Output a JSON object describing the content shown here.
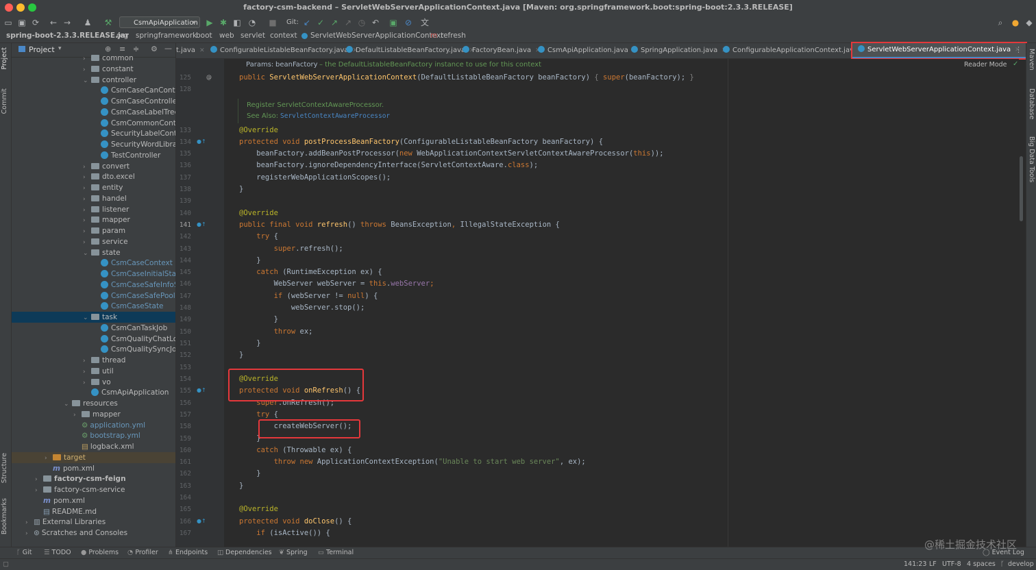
{
  "window": {
    "title": "factory-csm-backend – ServletWebServerApplicationContext.java [Maven: org.springframework.boot:spring-boot:2.3.3.RELEASE]"
  },
  "toolbar": {
    "run_config": "CsmApiApplication",
    "git_label": "Git:"
  },
  "navbar": {
    "crumbs": [
      "spring-boot-2.3.3.RELEASE.jar",
      "org",
      "springframework",
      "boot",
      "web",
      "servlet",
      "context",
      "ServletWebServerApplicationContext",
      "refresh"
    ]
  },
  "left_strip": {
    "project": "Project",
    "commit": "Commit",
    "structure": "Structure",
    "bookmarks": "Bookmarks"
  },
  "right_strip": {
    "maven": "Maven",
    "database": "Database",
    "bigdata": "Big Data Tools"
  },
  "project_panel": {
    "title": "Project",
    "tree": [
      {
        "label": "common",
        "type": "folder",
        "arrow": "›"
      },
      {
        "label": "constant",
        "type": "folder",
        "arrow": "›"
      },
      {
        "label": "controller",
        "type": "folder",
        "arrow": "⌄"
      },
      {
        "label": "CsmCaseCanControlle",
        "type": "class"
      },
      {
        "label": "CsmCaseController",
        "type": "class"
      },
      {
        "label": "CsmCaseLabelTreeCo",
        "type": "class"
      },
      {
        "label": "CsmCommonControlle",
        "type": "class"
      },
      {
        "label": "SecurityLabelControlle",
        "type": "class"
      },
      {
        "label": "SecurityWordLibraryCo",
        "type": "class"
      },
      {
        "label": "TestController",
        "type": "class"
      },
      {
        "label": "convert",
        "type": "folder",
        "arrow": "›"
      },
      {
        "label": "dto.excel",
        "type": "folder",
        "arrow": "›"
      },
      {
        "label": "entity",
        "type": "folder",
        "arrow": "›"
      },
      {
        "label": "handel",
        "type": "folder",
        "arrow": "›"
      },
      {
        "label": "listener",
        "type": "folder",
        "arrow": "›"
      },
      {
        "label": "mapper",
        "type": "folder",
        "arrow": "›"
      },
      {
        "label": "param",
        "type": "folder",
        "arrow": "›"
      },
      {
        "label": "service",
        "type": "folder",
        "arrow": "›"
      },
      {
        "label": "state",
        "type": "folder",
        "arrow": "⌄"
      },
      {
        "label": "CsmCaseContext",
        "type": "class",
        "vcs": true
      },
      {
        "label": "CsmCaseInitialState",
        "type": "class",
        "vcs": true
      },
      {
        "label": "CsmCaseSafeInfoStat",
        "type": "class",
        "vcs": true
      },
      {
        "label": "CsmCaseSafePoolStat",
        "type": "class",
        "vcs": true
      },
      {
        "label": "CsmCaseState",
        "type": "class",
        "vcs": true
      },
      {
        "label": "task",
        "type": "folder",
        "arrow": "⌄",
        "selected": true
      },
      {
        "label": "CsmCanTaskJob",
        "type": "class"
      },
      {
        "label": "CsmQualityChatLogJo",
        "type": "class"
      },
      {
        "label": "CsmQualitySyncJob",
        "type": "class"
      },
      {
        "label": "thread",
        "type": "folder",
        "arrow": "›"
      },
      {
        "label": "util",
        "type": "folder",
        "arrow": "›"
      },
      {
        "label": "vo",
        "type": "folder",
        "arrow": "›"
      },
      {
        "label": "CsmApiApplication",
        "type": "class"
      },
      {
        "label": "resources",
        "type": "folder",
        "arrow": "⌄"
      },
      {
        "label": "mapper",
        "type": "folder",
        "arrow": "›"
      },
      {
        "label": "application.yml",
        "type": "yml",
        "vcs": true
      },
      {
        "label": "bootstrap.yml",
        "type": "yml",
        "vcs": true
      },
      {
        "label": "logback.xml",
        "type": "xml"
      },
      {
        "label": "target",
        "type": "folder-orange",
        "arrow": "›",
        "excluded": true
      },
      {
        "label": "pom.xml",
        "type": "maven"
      },
      {
        "label": "factory-csm-feign",
        "type": "folder",
        "arrow": "›",
        "bold": true
      },
      {
        "label": "factory-csm-service",
        "type": "folder",
        "arrow": "›"
      },
      {
        "label": "pom.xml",
        "type": "maven"
      },
      {
        "label": "README.md",
        "type": "md"
      },
      {
        "label": "External Libraries",
        "type": "lib",
        "arrow": "›"
      },
      {
        "label": "Scratches and Consoles",
        "type": "scratch",
        "arrow": "›"
      }
    ]
  },
  "tabs": [
    {
      "label": "t.java"
    },
    {
      "label": "ConfigurableListableBeanFactory.java"
    },
    {
      "label": "DefaultListableBeanFactory.java"
    },
    {
      "label": "FactoryBean.java"
    },
    {
      "label": "CsmApiApplication.java"
    },
    {
      "label": "SpringApplication.java"
    },
    {
      "label": "ConfigurableApplicationContext.java"
    },
    {
      "label": "ServletWebServerApplicationContext.java",
      "active": true
    }
  ],
  "editor": {
    "reader_mode": "Reader Mode",
    "doc1_params": "Params:",
    "doc1_name": "beanFactory",
    "doc1_text": " – the DefaultListableBeanFactory instance to use for this context",
    "doc2_line1": "Register ServletContextAwareProcessor.",
    "doc2_see": "See Also:",
    "doc2_link": "ServletContextAwareProcessor",
    "line_numbers": [
      "125",
      "128",
      "133",
      "134",
      "135",
      "136",
      "137",
      "138",
      "139",
      "140",
      "141",
      "142",
      "143",
      "144",
      "145",
      "146",
      "147",
      "148",
      "149",
      "150",
      "151",
      "152",
      "153",
      "154",
      "155",
      "156",
      "157",
      "158",
      "159",
      "160",
      "161",
      "162",
      "163",
      "164",
      "165",
      "166",
      "167"
    ],
    "lines": [
      [
        [
          "kw",
          "public "
        ],
        [
          "fn",
          "ServletWebServerApplicationContext"
        ],
        [
          "",
          "(DefaultListableBeanFactory beanFactory) "
        ],
        [
          "cmt",
          "{ "
        ],
        [
          "kw",
          "super"
        ],
        [
          "",
          "(beanFactory); "
        ],
        [
          "cmt",
          "}"
        ]
      ],
      [],
      [
        [
          "ann",
          "@Override"
        ]
      ],
      [
        [
          "kw",
          "protected void "
        ],
        [
          "fn",
          "postProcessBeanFactory"
        ],
        [
          "",
          "(ConfigurableListableBeanFactory beanFactory) {"
        ]
      ],
      [
        [
          "",
          "    beanFactory.addBeanPostProcessor("
        ],
        [
          "kw",
          "new "
        ],
        [
          "",
          "WebApplicationContextServletContextAwareProcessor("
        ],
        [
          "kw",
          "this"
        ],
        [
          "",
          "));"
        ]
      ],
      [
        [
          "",
          "    beanFactory.ignoreDependencyInterface(ServletContextAware."
        ],
        [
          "kw",
          "class"
        ],
        [
          "",
          "); "
        ]
      ],
      [
        [
          "",
          "    registerWebApplicationScopes();"
        ]
      ],
      [
        [
          "",
          "}"
        ]
      ],
      [],
      [
        [
          "ann",
          "@Override"
        ]
      ],
      [
        [
          "kw",
          "public final void "
        ],
        [
          "fn",
          "refresh"
        ],
        [
          "",
          "() "
        ],
        [
          "kw",
          "throws "
        ],
        [
          "",
          "BeansException"
        ],
        [
          "kw",
          ", "
        ],
        [
          "",
          "IllegalStateException {"
        ]
      ],
      [
        [
          "kw",
          "    try "
        ],
        [
          "",
          "{"
        ]
      ],
      [
        [
          "kw",
          "        super"
        ],
        [
          "",
          ".refresh();"
        ]
      ],
      [
        [
          "",
          "    }"
        ]
      ],
      [
        [
          "kw",
          "    catch "
        ],
        [
          "",
          "(RuntimeException ex) {"
        ]
      ],
      [
        [
          "",
          "        WebServer webServer = "
        ],
        [
          "kw",
          "this"
        ],
        [
          "",
          "."
        ],
        [
          "fld",
          "webServer"
        ],
        [
          "kw",
          ";"
        ]
      ],
      [
        [
          "kw",
          "        if "
        ],
        [
          "",
          "(webServer != "
        ],
        [
          "kw",
          "null"
        ],
        [
          "",
          ") {"
        ]
      ],
      [
        [
          "",
          "            webServer.stop();"
        ]
      ],
      [
        [
          "",
          "        }"
        ]
      ],
      [
        [
          "kw",
          "        throw "
        ],
        [
          "",
          "ex;"
        ]
      ],
      [
        [
          "",
          "    }"
        ]
      ],
      [
        [
          "",
          "}"
        ]
      ],
      [],
      [
        [
          "ann",
          "@Override"
        ]
      ],
      [
        [
          "kw",
          "protected void "
        ],
        [
          "fn",
          "onRefresh"
        ],
        [
          "",
          "() {"
        ]
      ],
      [
        [
          "kw",
          "    super"
        ],
        [
          "",
          ".onRefresh();"
        ]
      ],
      [
        [
          "kw",
          "    try "
        ],
        [
          "",
          "{"
        ]
      ],
      [
        [
          "",
          "        createWebServer();"
        ]
      ],
      [
        [
          "",
          "    }"
        ]
      ],
      [
        [
          "kw",
          "    catch "
        ],
        [
          "",
          "(Throwable ex) {"
        ]
      ],
      [
        [
          "kw",
          "        throw new "
        ],
        [
          "",
          "ApplicationContextException("
        ],
        [
          "str",
          "\"Unable to start web server\""
        ],
        [
          "",
          ", ex);"
        ]
      ],
      [
        [
          "",
          "    }"
        ]
      ],
      [
        [
          "",
          "}"
        ]
      ],
      [],
      [
        [
          "ann",
          "@Override"
        ]
      ],
      [
        [
          "kw",
          "protected void "
        ],
        [
          "fn",
          "doClose"
        ],
        [
          "",
          "() {"
        ]
      ],
      [
        [
          "kw",
          "    if "
        ],
        [
          "",
          "(isActive()) {"
        ]
      ]
    ]
  },
  "bottom_tools": [
    "Git",
    "TODO",
    "Problems",
    "Profiler",
    "Endpoints",
    "Dependencies",
    "Spring",
    "Terminal",
    "Event Log"
  ],
  "status": {
    "position": "141:23",
    "line_sep": "LF",
    "encoding": "UTF-8",
    "indent": "4 spaces",
    "branch": "develop"
  },
  "watermark": "@稀土掘金技术社区",
  "colors": {
    "highlight": "#e5383b",
    "selection": "#0d3a58",
    "accent": "#4a88c7"
  }
}
